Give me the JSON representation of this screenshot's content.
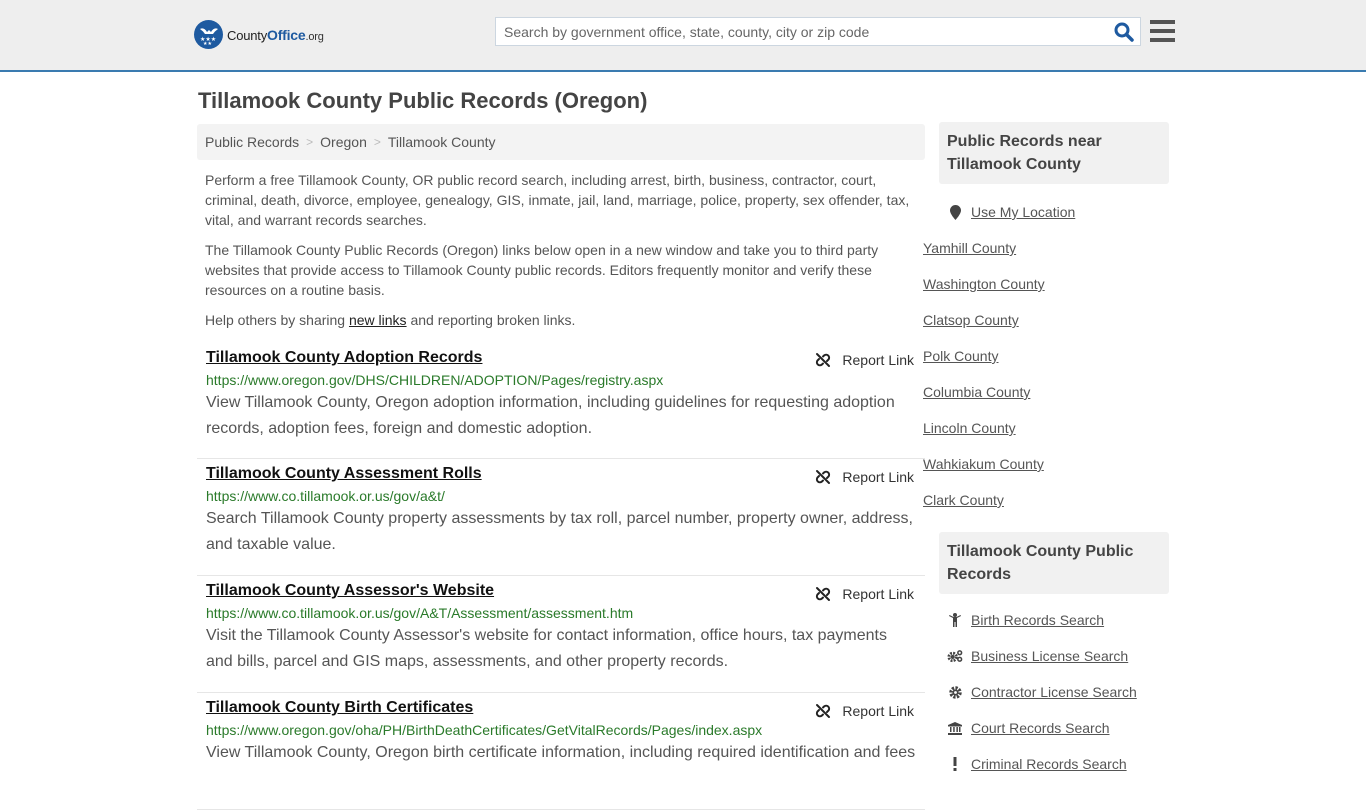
{
  "header": {
    "logo": {
      "name_part1": "County",
      "name_part2": "Office",
      "name_part3": ".org"
    },
    "search": {
      "placeholder": "Search by government office, state, county, city or zip code",
      "value": ""
    },
    "colors": {
      "brand": "#1e5aa0",
      "header_bg": "#eeeeee",
      "header_border": "#3a7bb0"
    }
  },
  "page": {
    "title": "Tillamook County Public Records (Oregon)",
    "breadcrumb": [
      "Public Records",
      "Oregon",
      "Tillamook County"
    ],
    "intro": {
      "p1": "Perform a free Tillamook County, OR public record search, including arrest, birth, business, contractor, court, criminal, death, divorce, employee, genealogy, GIS, inmate, jail, land, marriage, police, property, sex offender, tax, vital, and warrant records searches.",
      "p2": "The Tillamook County Public Records (Oregon) links below open in a new window and take you to third party websites that provide access to Tillamook County public records. Editors frequently monitor and verify these resources on a routine basis.",
      "p3_before": "Help others by sharing ",
      "p3_link": "new links",
      "p3_after": " and reporting broken links."
    },
    "report_label": "Report Link",
    "entries": [
      {
        "title": "Tillamook County Adoption Records",
        "url": "https://www.oregon.gov/DHS/CHILDREN/ADOPTION/Pages/registry.aspx",
        "desc": "View Tillamook County, Oregon adoption information, including guidelines for requesting adoption records, adoption fees, foreign and domestic adoption."
      },
      {
        "title": "Tillamook County Assessment Rolls",
        "url": "https://www.co.tillamook.or.us/gov/a&t/",
        "desc": "Search Tillamook County property assessments by tax roll, parcel number, property owner, address, and taxable value."
      },
      {
        "title": "Tillamook County Assessor's Website",
        "url": "https://www.co.tillamook.or.us/gov/A&T/Assessment/assessment.htm",
        "desc": "Visit the Tillamook County Assessor's website for contact information, office hours, tax payments and bills, parcel and GIS maps, assessments, and other property records."
      },
      {
        "title": "Tillamook County Birth Certificates",
        "url": "https://www.oregon.gov/oha/PH/BirthDeathCertificates/GetVitalRecords/Pages/index.aspx",
        "desc": "View Tillamook County, Oregon birth certificate information, including required identification and fees"
      }
    ]
  },
  "sidebar": {
    "nearby": {
      "heading": "Public Records near Tillamook County",
      "use_location": "Use My Location",
      "items": [
        "Yamhill County",
        "Washington County",
        "Clatsop County",
        "Polk County",
        "Columbia County",
        "Lincoln County",
        "Wahkiakum County",
        "Clark County"
      ]
    },
    "county_records": {
      "heading": "Tillamook County Public Records",
      "items": [
        {
          "label": "Birth Records Search",
          "icon": "child-icon"
        },
        {
          "label": "Business License Search",
          "icon": "gears-icon"
        },
        {
          "label": "Contractor License Search",
          "icon": "gear-icon"
        },
        {
          "label": "Court Records Search",
          "icon": "courthouse-icon"
        },
        {
          "label": "Criminal Records Search",
          "icon": "exclamation-icon"
        }
      ]
    }
  }
}
